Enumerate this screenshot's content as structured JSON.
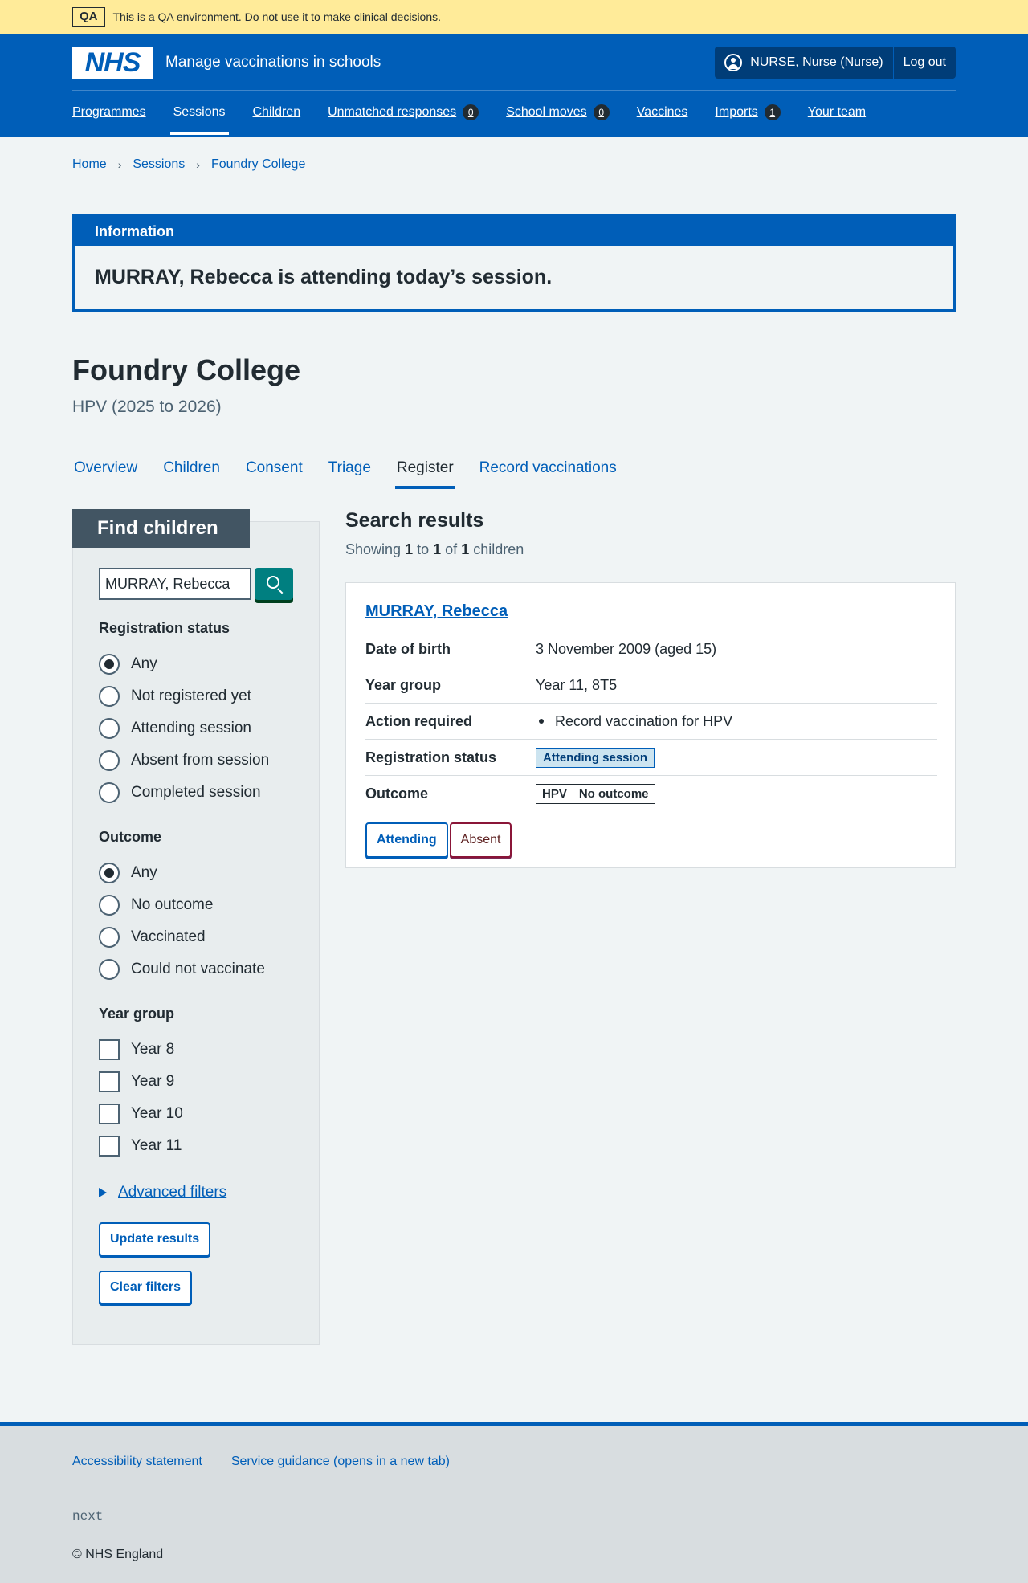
{
  "qa_banner": {
    "tag": "QA",
    "message": "This is a QA environment. Do not use it to make clinical decisions."
  },
  "header": {
    "logo": "NHS",
    "service_name": "Manage vaccinations in schools",
    "user": "NURSE, Nurse (Nurse)",
    "logout": "Log out",
    "nav": [
      {
        "label": "Programmes"
      },
      {
        "label": "Sessions",
        "active": true
      },
      {
        "label": "Children"
      },
      {
        "label": "Unmatched responses",
        "count": "0"
      },
      {
        "label": "School moves",
        "count": "0"
      },
      {
        "label": "Vaccines"
      },
      {
        "label": "Imports",
        "count": "1"
      },
      {
        "label": "Your team"
      }
    ]
  },
  "breadcrumb": [
    "Home",
    "Sessions",
    "Foundry College"
  ],
  "info_banner": {
    "title": "Information",
    "message": "MURRAY, Rebecca is attending today’s session."
  },
  "page": {
    "title": "Foundry College",
    "caption": "HPV (2025 to 2026)"
  },
  "tabs": [
    "Overview",
    "Children",
    "Consent",
    "Triage",
    "Register",
    "Record vaccinations"
  ],
  "active_tab": "Register",
  "filters": {
    "heading": "Find children",
    "search_value": "MURRAY, Rebecca",
    "registration": {
      "legend": "Registration status",
      "options": [
        "Any",
        "Not registered yet",
        "Attending session",
        "Absent from session",
        "Completed session"
      ],
      "selected": "Any"
    },
    "outcome": {
      "legend": "Outcome",
      "options": [
        "Any",
        "No outcome",
        "Vaccinated",
        "Could not vaccinate"
      ],
      "selected": "Any"
    },
    "year_group": {
      "legend": "Year group",
      "options": [
        "Year 8",
        "Year 9",
        "Year 10",
        "Year 11"
      ]
    },
    "advanced": "Advanced filters",
    "update_button": "Update results",
    "clear_button": "Clear filters"
  },
  "results": {
    "title": "Search results",
    "count_prefix": "Showing",
    "from": "1",
    "to_word": "to",
    "to": "1",
    "of_word": "of",
    "total": "1",
    "suffix": "children",
    "card": {
      "name": "MURRAY, Rebecca",
      "rows": {
        "dob_label": "Date of birth",
        "dob_value": "3 November 2009 (aged 15)",
        "year_label": "Year group",
        "year_value": "Year 11, 8T5",
        "action_label": "Action required",
        "action_value": "Record vaccination for HPV",
        "reg_label": "Registration status",
        "reg_value": "Attending session",
        "outcome_label": "Outcome",
        "outcome_programme": "HPV",
        "outcome_value": "No outcome"
      },
      "attending_button": "Attending",
      "absent_button": "Absent"
    }
  },
  "footer": {
    "links": [
      "Accessibility statement",
      "Service guidance (opens in a new tab)"
    ],
    "version": "next",
    "copyright": "© NHS England"
  },
  "colors": {
    "nhs_blue": "#005eb8",
    "qa_yellow": "#ffeb99",
    "teal": "#007f80"
  }
}
